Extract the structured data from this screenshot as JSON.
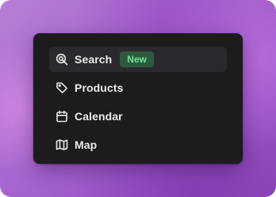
{
  "colors": {
    "menu_bg": "#1c1c1f",
    "active_bg": "#2a2a2e",
    "badge_bg": "#2d5a3c",
    "badge_text": "#6ee79a"
  },
  "menu": {
    "items": [
      {
        "label": "Search",
        "icon": "search-icon",
        "badge": "New",
        "active": true
      },
      {
        "label": "Products",
        "icon": "tag-icon"
      },
      {
        "label": "Calendar",
        "icon": "calendar-icon"
      },
      {
        "label": "Map",
        "icon": "map-icon"
      }
    ]
  }
}
